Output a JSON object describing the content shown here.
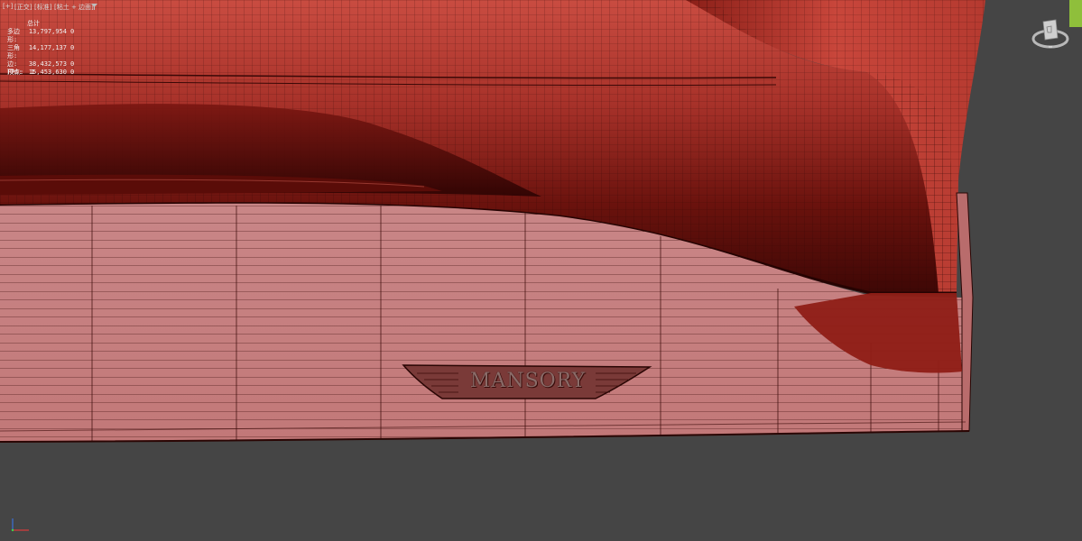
{
  "viewport": {
    "labels": [
      "[+]",
      "[正交]",
      "[标准]",
      "[粘土 + 边面]"
    ],
    "filter_icon": "funnel-icon"
  },
  "stats": {
    "header": "总计",
    "rows": [
      {
        "label": "多边形:",
        "value": "13,797,954",
        "selected": "0"
      },
      {
        "label": "三角形:",
        "value": "14,177,137",
        "selected": "0"
      },
      {
        "label": "边:",
        "value": "38,432,573",
        "selected": "0"
      },
      {
        "label": "顶点:",
        "value": "15,453,630",
        "selected": "0"
      }
    ],
    "fps_label": "FPS:",
    "fps_value": "1"
  },
  "model": {
    "logo_text": "MANSORY"
  },
  "colors": {
    "background": "#454545",
    "clay_red": "#c6473d",
    "clay_dark": "#4a0a06",
    "side_skirt": "#c97f80",
    "wire": "#2a0604",
    "accent_green": "#8fbf3b"
  }
}
